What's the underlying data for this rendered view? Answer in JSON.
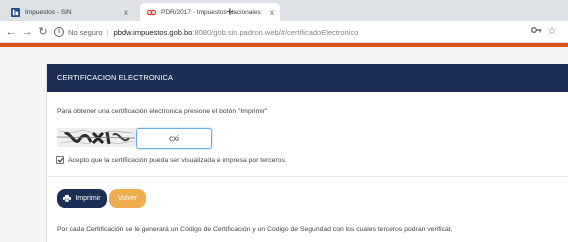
{
  "browser": {
    "tabs": [
      {
        "title": "Impuestos - SIN",
        "active": false
      },
      {
        "title": "PDR/2017 - Impuestos Nacionales",
        "active": true
      }
    ],
    "new_tab": "+",
    "tab_close": "x",
    "security_label": "No seguro",
    "url_host": "pbdw.impuestos.gob.bo",
    "url_path": ":8080/gob.sin.padron.web/#/certificadoElectronico",
    "icons": [
      "back-icon",
      "forward-icon",
      "reload-icon",
      "info-icon",
      "key-icon",
      "star-icon",
      "profile-icon"
    ]
  },
  "panel": {
    "title": "CERTIFICACION ELECTRONICA",
    "instructions": "Para obtener una certificación electronica presione el botón \"Imprimir\"",
    "captcha": {
      "value": "cxi"
    },
    "accept_label": "Acepto que la certificación pueda ser visualizada e impresa por terceros.",
    "accept_checked": true,
    "buttons": {
      "print": "Imprimir",
      "back": "Volver"
    },
    "footer_note": "Por cada Certificación se le generará un Código de Certificación y un Código de Seguridad con los cuales terceros podran verificar."
  },
  "colors": {
    "header_navy": "#1c2e55",
    "accent_orange": "#d9531e",
    "back_button": "#f0ad4e"
  }
}
